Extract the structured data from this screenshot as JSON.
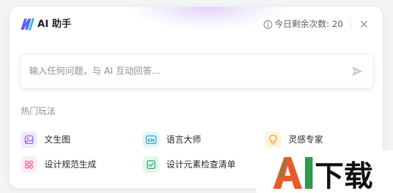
{
  "header": {
    "title": "AI 助手",
    "quota_label": "今日剩余次数: 20",
    "logo_icon": "ai-logo-icon",
    "info_icon": "info-icon",
    "close_icon": "close-icon"
  },
  "input": {
    "placeholder": "输入任何问题，与 AI 互动回答...",
    "value": "",
    "send_icon": "send-icon"
  },
  "popular": {
    "title": "热门玩法",
    "items": [
      {
        "label": "文生图",
        "icon": "image-icon",
        "color": "#8b5cf6",
        "bg": "#f1ebff"
      },
      {
        "label": "语言大师",
        "icon": "language-icon",
        "color": "#1da1c2",
        "bg": "#e3f5fa"
      },
      {
        "label": "灵感专家",
        "icon": "lightbulb-icon",
        "color": "#f59e0b",
        "bg": "#fff3e0"
      },
      {
        "label": "设计规范生成",
        "icon": "grid-icon",
        "color": "#ec4899",
        "bg": "#fdecf3"
      },
      {
        "label": "设计元素检查清单",
        "icon": "checkbox-icon",
        "color": "#22a46b",
        "bg": "#e4f6ec"
      }
    ]
  },
  "watermark": {
    "text": "AI下载",
    "colors": {
      "a": "#e85a2c",
      "i": "#2e9b4f",
      "rest": "#111111"
    }
  }
}
